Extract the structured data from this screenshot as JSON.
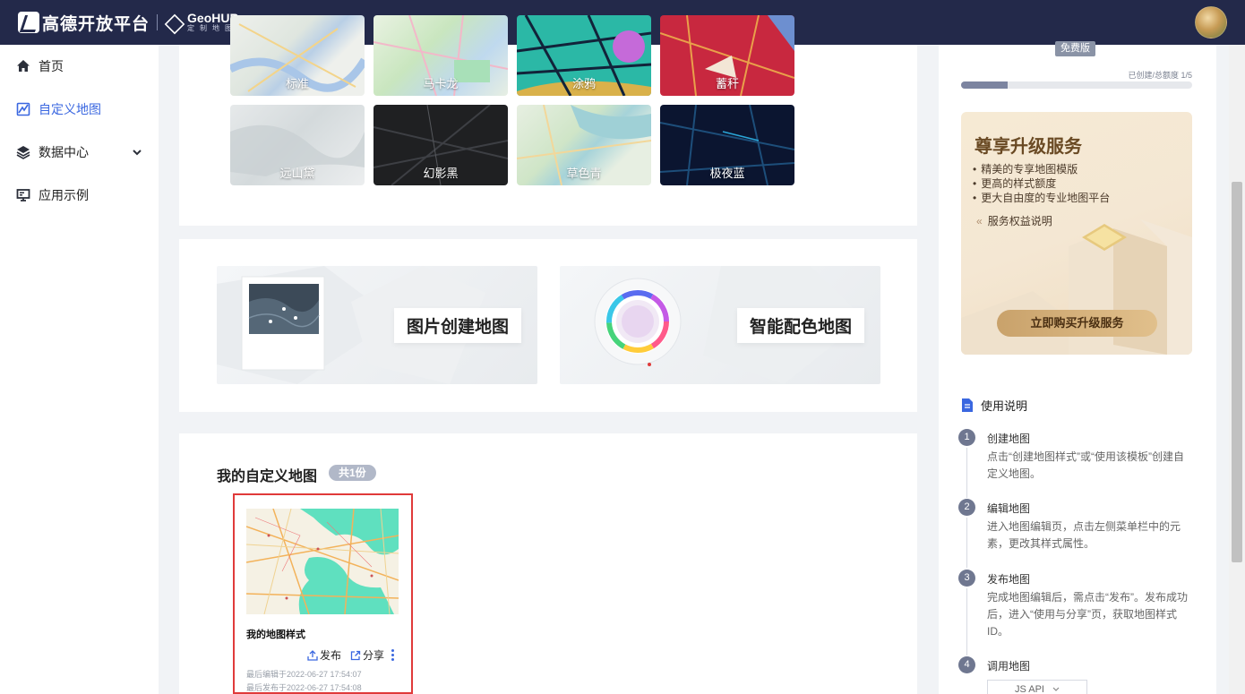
{
  "header": {
    "brand": "高德开放平台",
    "product": "GeoHUB",
    "product_sub": "定制地图"
  },
  "sidebar": {
    "items": [
      {
        "label": "首页",
        "icon": "home-icon"
      },
      {
        "label": "自定义地图",
        "icon": "custom-map-icon",
        "active": true
      },
      {
        "label": "数据中心",
        "icon": "layers-icon",
        "expandable": true
      },
      {
        "label": "应用示例",
        "icon": "monitor-icon"
      }
    ]
  },
  "templates": [
    {
      "label": "标准"
    },
    {
      "label": "马卡龙"
    },
    {
      "label": "涂鸦"
    },
    {
      "label": "蓄秆"
    },
    {
      "label": "远山黛"
    },
    {
      "label": "幻影黑"
    },
    {
      "label": "草色青"
    },
    {
      "label": "极夜蓝"
    }
  ],
  "create": {
    "image_label": "图片创建地图",
    "color_label": "智能配色地图"
  },
  "my_maps": {
    "title": "我的自定义地图",
    "count_label": "共1份",
    "items": [
      {
        "name": "我的地图样式",
        "publish_label": "发布",
        "share_label": "分享",
        "edited": "最后编辑于2022-06-27 17:54:07",
        "published": "最后发布于2022-06-27 17:54:08"
      }
    ]
  },
  "right": {
    "plan_badge": "免费版",
    "quota_text": "已创建/总额度  1/5",
    "quota_fraction": 0.2,
    "promo": {
      "title": "尊享升级服务",
      "bullets": [
        "精美的专享地图模版",
        "更高的样式额度",
        "更大自由度的专业地图平台"
      ],
      "link": "服务权益说明",
      "button": "立即购买升级服务"
    },
    "guide": {
      "title": "使用说明",
      "steps": [
        {
          "num": "1",
          "title": "创建地图",
          "desc": "点击“创建地图样式”或“使用该模板”创建自定义地图。"
        },
        {
          "num": "2",
          "title": "编辑地图",
          "desc": "进入地图编辑页，点击左侧菜单栏中的元素，更改其样式属性。"
        },
        {
          "num": "3",
          "title": "发布地图",
          "desc": "完成地图编辑后，需点击“发布”。发布成功后，进入“使用与分享”页，获取地图样式ID。"
        },
        {
          "num": "4",
          "title": "调用地图",
          "desc": ""
        }
      ],
      "api_select": "JS API"
    }
  },
  "colors": {
    "topbar": "#23294a",
    "accent": "#3a67e0",
    "highlight_border": "#e03a3a"
  }
}
